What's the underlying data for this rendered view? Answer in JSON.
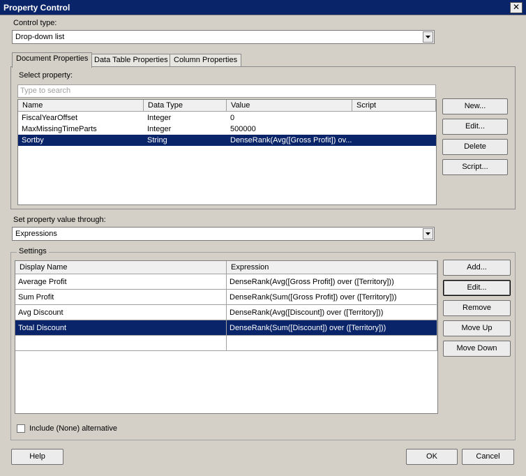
{
  "window": {
    "title": "Property Control",
    "close_glyph": "✕"
  },
  "control_type": {
    "label": "Control type:",
    "value": "Drop-down list"
  },
  "tabs": [
    {
      "label": "Document Properties"
    },
    {
      "label": "Data Table Properties"
    },
    {
      "label": "Column Properties"
    }
  ],
  "select_property": {
    "label": "Select property:",
    "search_placeholder": "Type to search",
    "columns": [
      "Name",
      "Data Type",
      "Value",
      "Script"
    ],
    "rows": [
      {
        "name": "FiscalYearOffset",
        "type": "Integer",
        "value": "0",
        "script": ""
      },
      {
        "name": "MaxMissingTimeParts",
        "type": "Integer",
        "value": "500000",
        "script": ""
      },
      {
        "name": "Sortby",
        "type": "String",
        "value": "DenseRank(Avg([Gross Profit]) ov...",
        "script": ""
      }
    ],
    "selected_row": "Sortby"
  },
  "property_buttons": {
    "new": "New...",
    "edit": "Edit...",
    "delete": "Delete",
    "script": "Script..."
  },
  "set_value": {
    "label": "Set property value through:",
    "value": "Expressions"
  },
  "settings": {
    "label": "Settings",
    "columns": [
      "Display Name",
      "Expression"
    ],
    "rows": [
      {
        "display": "Average Profit",
        "expression": "DenseRank(Avg([Gross Profit]) over ([Territory]))"
      },
      {
        "display": "Sum Profit",
        "expression": "DenseRank(Sum([Gross Profit]) over ([Territory]))"
      },
      {
        "display": "Avg Discount",
        "expression": "DenseRank(Avg([Discount]) over ([Territory]))"
      },
      {
        "display": "Total Discount",
        "expression": "DenseRank(Sum([Discount]) over ([Territory]))"
      }
    ],
    "selected_row": "Total Discount",
    "buttons": {
      "add": "Add...",
      "edit": "Edit...",
      "remove": "Remove",
      "move_up": "Move Up",
      "move_down": "Move Down"
    }
  },
  "include_none": {
    "label": "Include (None) alternative",
    "checked": false
  },
  "footer": {
    "help": "Help",
    "ok": "OK",
    "cancel": "Cancel"
  },
  "colors": {
    "selection": "#0a246a",
    "dialog_bg": "#d4d0c8"
  },
  "icons": {
    "dropdown": "chevron-down-icon",
    "close": "close-icon",
    "checkbox": "checkbox-icon"
  }
}
